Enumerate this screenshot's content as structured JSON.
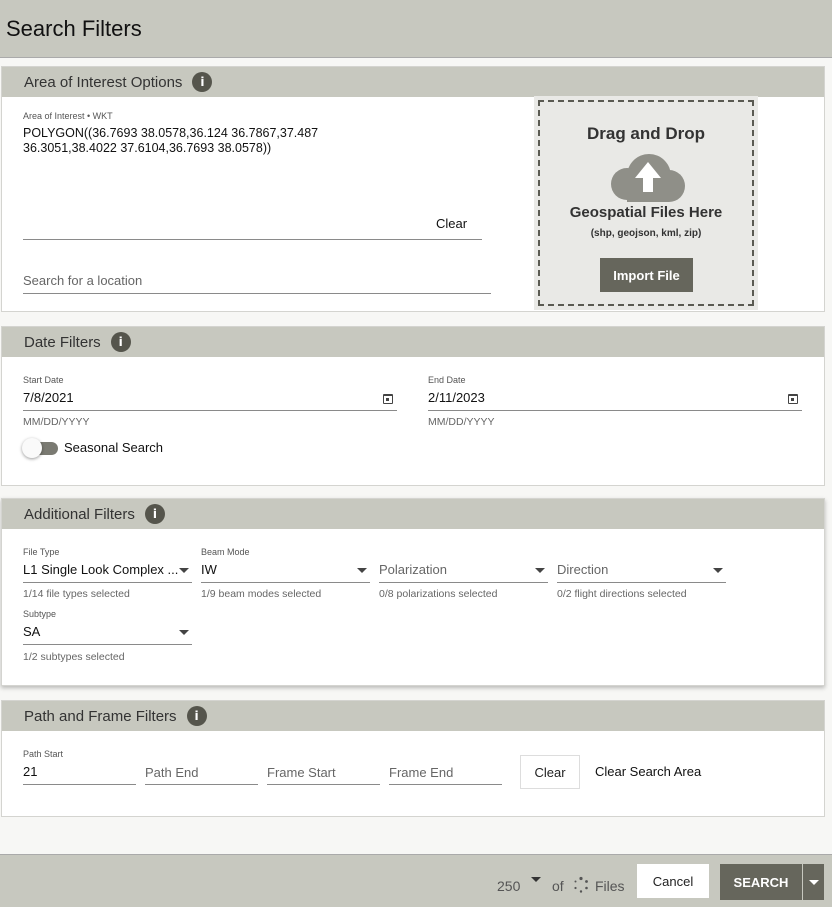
{
  "header": {
    "title": "Search Filters"
  },
  "aoi": {
    "title": "Area of Interest Options",
    "wkt_label": "Area of Interest • WKT",
    "wkt_line1": "POLYGON((36.7693 38.0578,36.124 36.7867,37.487",
    "wkt_line2": "36.3051,38.4022 37.6104,36.7693 38.0578))",
    "clear_label": "Clear",
    "search_placeholder": "Search for a location",
    "dropzone": {
      "title": "Drag and Drop",
      "subtitle": "Geospatial Files Here",
      "formats": "(shp, geojson, kml, zip)",
      "import_label": "Import File"
    }
  },
  "dates": {
    "title": "Date Filters",
    "start_label": "Start Date",
    "start_value": "7/8/2021",
    "start_hint": "MM/DD/YYYY",
    "end_label": "End Date",
    "end_value": "2/11/2023",
    "end_hint": "MM/DD/YYYY",
    "seasonal_label": "Seasonal Search"
  },
  "additional": {
    "title": "Additional Filters",
    "file_type": {
      "label": "File Type",
      "value": "L1 Single Look Complex ...",
      "hint": "1/14 file types selected"
    },
    "beam_mode": {
      "label": "Beam Mode",
      "value": "IW",
      "hint": "1/9 beam modes selected"
    },
    "polarization": {
      "placeholder": "Polarization",
      "hint": "0/8 polarizations selected"
    },
    "direction": {
      "placeholder": "Direction",
      "hint": "0/2 flight directions selected"
    },
    "subtype": {
      "label": "Subtype",
      "value": "SA",
      "hint": "1/2 subtypes selected"
    }
  },
  "path_frame": {
    "title": "Path and Frame Filters",
    "path_start_label": "Path Start",
    "path_start_value": "21",
    "path_end_placeholder": "Path End",
    "frame_start_placeholder": "Frame Start",
    "frame_end_placeholder": "Frame End",
    "clear_label": "Clear",
    "clear_area_label": "Clear Search Area"
  },
  "footer": {
    "max_results": "250",
    "of_label": "of",
    "files_label": "Files",
    "cancel_label": "Cancel",
    "search_label": "SEARCH"
  }
}
